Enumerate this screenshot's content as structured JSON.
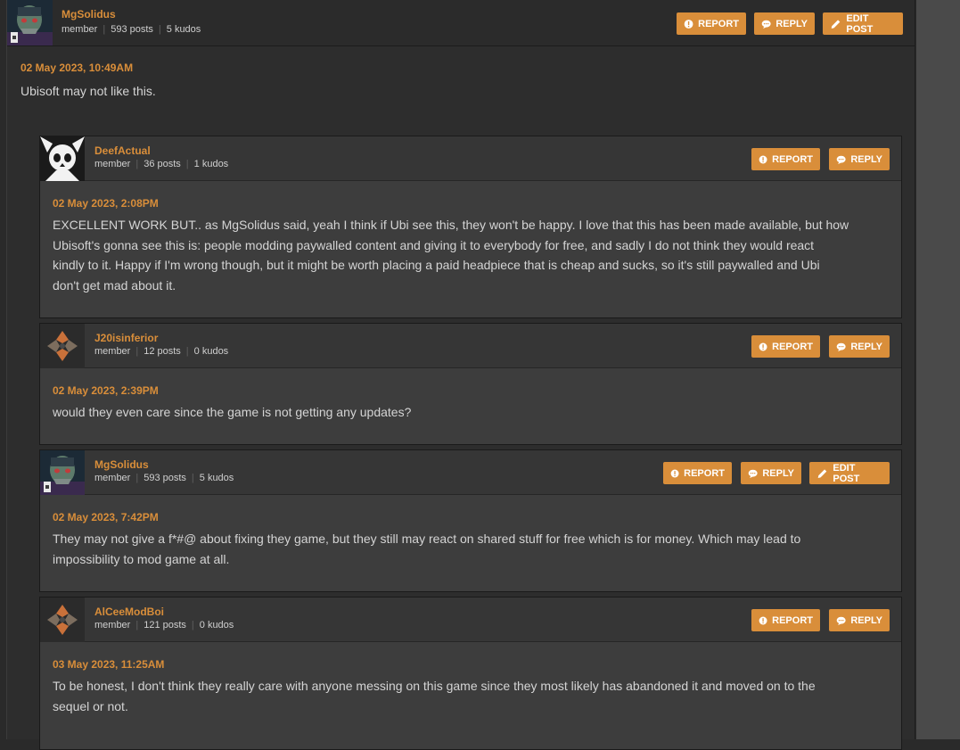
{
  "posts": [
    {
      "author": "MgSolidus",
      "role": "member",
      "posts": "593 posts",
      "kudos": "5 kudos",
      "date": "02 May 2023, 10:49AM",
      "text": "Ubisoft may not like this.",
      "report_label": "REPORT",
      "reply_label": "REPLY",
      "edit_label": "EDIT POST"
    }
  ],
  "replies": [
    {
      "author": "DeefActual",
      "role": "member",
      "posts": "36 posts",
      "kudos": "1 kudos",
      "date": "02 May 2023, 2:08PM",
      "text_lines": [
        "EXCELLENT WORK BUT.. as MgSolidus said, yeah I think if Ubi see this, they won't be happy. I love that this has been made available, but how",
        "Ubisoft's gonna see this is: people modding paywalled content and giving it to everybody for free, and sadly I do not think they would react",
        "kindly to it. Happy if I'm wrong though, but it might be worth placing a paid headpiece that is cheap and sucks, so it's still paywalled and Ubi",
        "don't get mad about it."
      ],
      "report_label": "REPORT",
      "reply_label": "REPLY"
    },
    {
      "author": "J20isinferior",
      "role": "member",
      "posts": "12 posts",
      "kudos": "0 kudos",
      "date": "02 May 2023, 2:39PM",
      "text_lines": [
        "would they even care since the game is not getting any updates?"
      ],
      "report_label": "REPORT",
      "reply_label": "REPLY"
    },
    {
      "author": "MgSolidus",
      "role": "member",
      "posts": "593 posts",
      "kudos": "5 kudos",
      "date": "02 May 2023, 7:42PM",
      "text_lines": [
        "They may not give a f*#@ about fixing they game, but they still may react on shared stuff for free which is for money. Which may lead to",
        "impossibility to mod game at all."
      ],
      "report_label": "REPORT",
      "reply_label": "REPLY",
      "edit_label": "EDIT POST"
    },
    {
      "author": "AlCeeModBoi",
      "role": "member",
      "posts": "121 posts",
      "kudos": "0 kudos",
      "date": "03 May 2023, 11:25AM",
      "text_lines": [
        "To be honest, I don't think they really care with anyone messing on this game since they most likely has abandoned it and moved on to the",
        "sequel or not."
      ],
      "report_label": "REPORT",
      "reply_label": "REPLY"
    }
  ],
  "colors": {
    "accent": "#d98e3a",
    "background": "#2d2d2d",
    "reply_background": "#3d3d3d"
  }
}
